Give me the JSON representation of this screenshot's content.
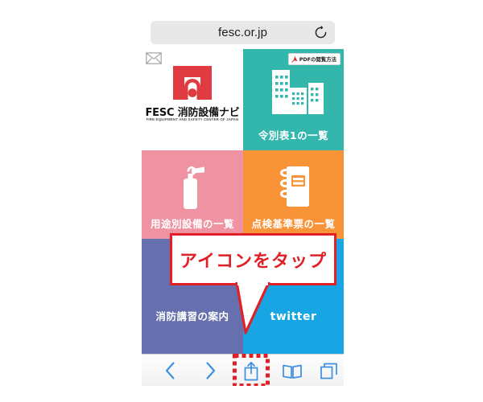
{
  "browser": {
    "url": "fesc.or.jp",
    "reload_icon": "reload-icon"
  },
  "site": {
    "logo_title": "FESC 消防設備ナビ",
    "logo_subtitle": "FIRE EQUIPMENT AND SAFETY CENTER OF JAPAN",
    "mail_icon": "envelope-icon",
    "logo_icon": "fesc-logo-mark"
  },
  "pdf_badge": {
    "label": "PDFの閲覧方法",
    "icon": "adobe-pdf-icon"
  },
  "tiles": [
    {
      "id": "logo",
      "label": "",
      "color": "#ffffff",
      "icon": "fesc-logo-mark"
    },
    {
      "id": "teal",
      "label": "令別表1の一覧",
      "color": "#33b7ac",
      "icon": "buildings-icon"
    },
    {
      "id": "pink",
      "label": "用途別設備の一覧",
      "color": "#ef93a3",
      "icon": "fire-extinguisher-icon"
    },
    {
      "id": "orange",
      "label": "点検基準票の一覧",
      "color": "#f89338",
      "icon": "notebook-icon"
    },
    {
      "id": "purple",
      "label": "消防講習の案内",
      "color": "#6770ae",
      "icon": ""
    },
    {
      "id": "blue",
      "label": "twitter",
      "color": "#18a5e4",
      "icon": ""
    }
  ],
  "callout": {
    "text": "アイコンをタップ",
    "border_color": "#e01f26",
    "text_color": "#e01f26"
  },
  "toolbar": {
    "accent_color": "#3b8fe0",
    "buttons": [
      {
        "id": "back",
        "icon": "chevron-left-icon",
        "label": ""
      },
      {
        "id": "fwd",
        "icon": "chevron-right-icon",
        "label": ""
      },
      {
        "id": "share",
        "icon": "share-icon",
        "label": ""
      },
      {
        "id": "book",
        "icon": "bookmarks-icon",
        "label": ""
      },
      {
        "id": "tabs",
        "icon": "tabs-icon",
        "label": ""
      }
    ],
    "highlight_color": "#e01f26"
  }
}
